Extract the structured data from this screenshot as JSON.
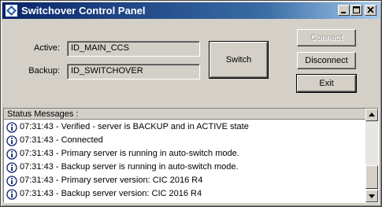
{
  "window": {
    "title": "Switchover Control Panel"
  },
  "form": {
    "active_label": "Active:",
    "active_value": "ID_MAIN_CCS",
    "backup_label": "Backup:",
    "backup_value": "ID_SWITCHOVER"
  },
  "buttons": {
    "switch": "Switch",
    "connect": "Connect",
    "disconnect": "Disconnect",
    "exit": "Exit"
  },
  "status": {
    "header": "Status Messages :",
    "messages": [
      "07:31:43 - Verified - server is BACKUP and in ACTIVE state",
      "07:31:43 - Connected",
      "07:31:43 - Primary server is running in auto-switch mode.",
      "07:31:43 - Backup server is running in auto-switch mode.",
      "07:31:43 - Primary server version: CIC 2016 R4",
      "07:31:43 - Backup server version: CIC 2016 R4"
    ]
  },
  "icons": {
    "app": "app-diamond-icon",
    "message": "info-icon"
  }
}
